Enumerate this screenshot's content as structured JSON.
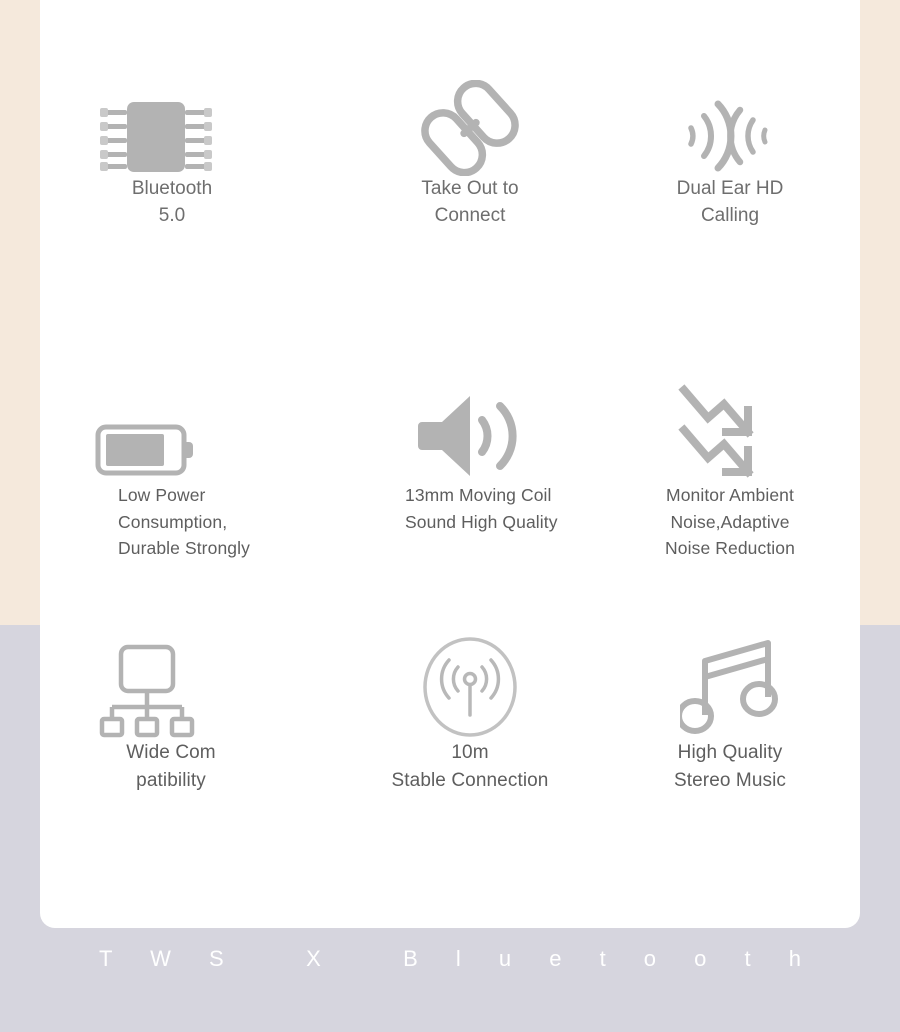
{
  "palette": {
    "bg_upper": "#f5e9dc",
    "bg_lower": "#d6d5de",
    "card": "#ffffff",
    "icon_gray": "#b0b0b0",
    "text_row1": "#6e6e6e",
    "text_rows23": "#5e5e5e",
    "banner_text": "#ffffff"
  },
  "features": [
    {
      "icon": "chip-icon",
      "label": "Bluetooth\n5.0",
      "align": "center"
    },
    {
      "icon": "link-chain-icon",
      "label": "Take Out to\nConnect",
      "align": "center"
    },
    {
      "icon": "dual-ear-soundwave-icon",
      "label": "Dual Ear HD\nCalling",
      "align": "center"
    },
    {
      "icon": "battery-icon",
      "label": "Low Power\nConsumption,\nDurable Strongly",
      "align": "left"
    },
    {
      "icon": "speaker-volume-icon",
      "label": "13mm Moving Coil\nSound High Quality",
      "align": "left"
    },
    {
      "icon": "noise-reduction-arrows-icon",
      "label": "Monitor Ambient\nNoise,Adaptive\nNoise Reduction",
      "align": "center"
    },
    {
      "icon": "network-hierarchy-icon",
      "label": "Wide Com\npatibility",
      "align": "center"
    },
    {
      "icon": "antenna-signal-circle-icon",
      "label": "10m\nStable Connection",
      "align": "center"
    },
    {
      "icon": "music-note-icon",
      "label": "High Quality\nStereo Music",
      "align": "center"
    }
  ],
  "banner": {
    "text": "T W S   X   B l u e t o o t h"
  }
}
